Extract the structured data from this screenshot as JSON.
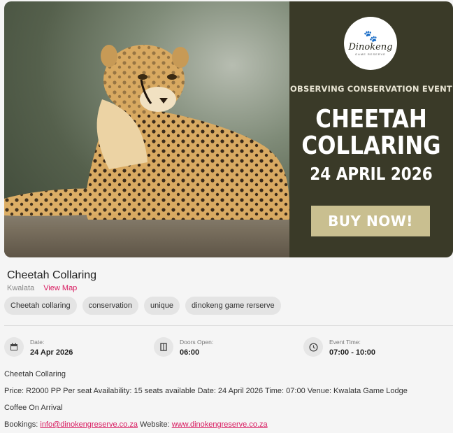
{
  "banner": {
    "logo": {
      "name": "Dinokeng",
      "tagline": "GAME RESERVE"
    },
    "subtitle": "OBSERVING CONSERVATION EVENT",
    "headline_line1": "CHEETAH",
    "headline_line2": "COLLARING",
    "date": "24 APRIL 2026",
    "cta": "BUY NOW!"
  },
  "event": {
    "title": "Cheetah Collaring",
    "location": "Kwalata",
    "view_map": "View Map",
    "tags": [
      "Cheetah collaring",
      "conservation",
      "unique",
      "dinokeng game rerserve"
    ]
  },
  "meta": {
    "date": {
      "label": "Date:",
      "value": "24 Apr 2026",
      "icon": "calendar-icon"
    },
    "doors": {
      "label": "Doors Open:",
      "value": "06:00",
      "icon": "door-icon"
    },
    "time": {
      "label": "Event Time:",
      "value": "07:00 - 10:00",
      "icon": "clock-icon"
    }
  },
  "description": {
    "line1": "Cheetah Collaring",
    "line2": "Price: R2000 PP Per seat Availability: 15 seats available Date: 24 April 2026 Time: 07:00 Venue: Kwalata Game Lodge",
    "line3": "Coffee On Arrival",
    "bookings_label": "Bookings: ",
    "email": "info@dinokengreserve.co.za",
    "website_label": " Website: ",
    "website": "www.dinokengreserve.co.za"
  },
  "colors": {
    "accent": "#d81b60",
    "promo_bg": "#3a3a28",
    "cta_bg": "#c9bf90"
  }
}
